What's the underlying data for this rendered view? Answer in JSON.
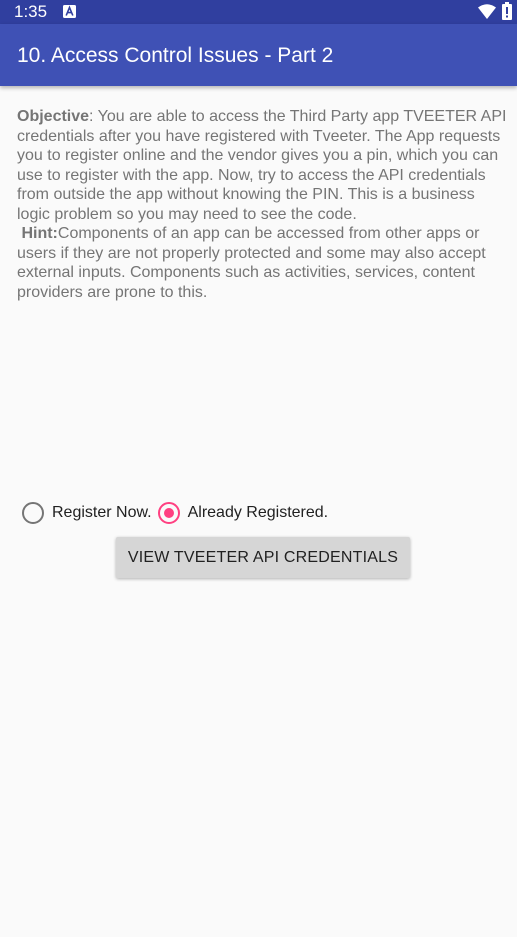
{
  "status_bar": {
    "time": "1:35",
    "icons": [
      "notification-a-icon",
      "wifi-icon",
      "battery-icon"
    ]
  },
  "app_bar": {
    "title": "10. Access Control Issues - Part 2",
    "color": "#3f51b5",
    "status_color": "#303f9f"
  },
  "content": {
    "objective_label": "Objective",
    "objective_text": ": You are able to access the Third Party app TVEETER API credentials after you have registered with Tveeter. The App requests you to register online and the vendor gives you a pin, which you can use to register with the app. Now, try to access the API credentials from outside the app without knowing the PIN. This is a business logic problem so you may need to see the code.",
    "hint_label": "Hint:",
    "hint_text": "Components of an app can be accessed from other apps or users if they are not properly protected and some may also accept external inputs. Components such as activities, services, content providers are prone to this."
  },
  "radio_group": {
    "options": [
      {
        "label": "Register Now.",
        "checked": false
      },
      {
        "label": "Already Registered.",
        "checked": true
      }
    ],
    "accent_color": "#ff4081"
  },
  "button": {
    "label": "View Tveeter API Credentials"
  }
}
